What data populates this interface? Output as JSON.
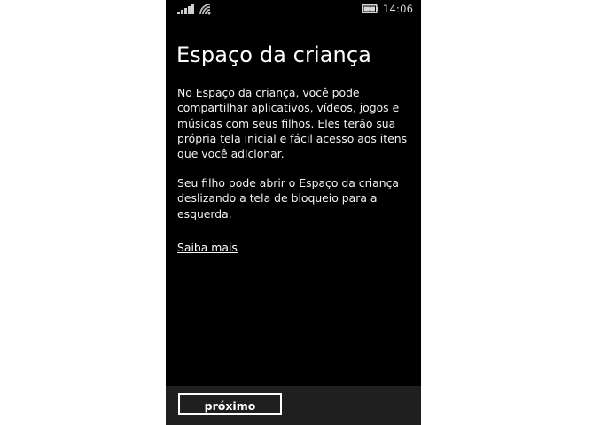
{
  "status_bar": {
    "time": "14:06",
    "icons": [
      "signal-strength-icon",
      "wifi-icon",
      "battery-saver-icon"
    ]
  },
  "screen": {
    "title": "Espaço da criança",
    "paragraphs": [
      "No Espaço da criança, você pode compartilhar aplicativos, vídeos, jogos e músicas com seus filhos. Eles terão sua própria tela inicial e fácil acesso aos itens que você adicionar.",
      "Seu filho pode abrir o Espaço da criança deslizando a tela de bloqueio para a esquerda."
    ],
    "learn_more_link": "Saiba mais"
  },
  "app_bar": {
    "next_label": "próximo"
  },
  "colors": {
    "background": "#000000",
    "text": "#ffffff",
    "app_bar": "#1f1f1f"
  }
}
